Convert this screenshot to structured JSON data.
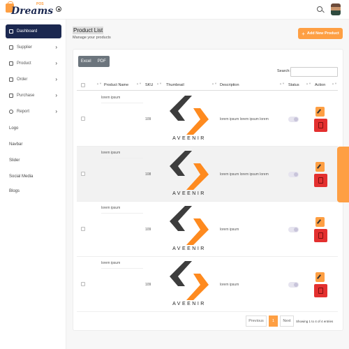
{
  "brand": {
    "small_text": "",
    "name": "Dreams",
    "pos": "POS"
  },
  "sidebar": {
    "items": [
      {
        "label": "Dashboard",
        "icon": "home-icon",
        "active": true
      },
      {
        "label": "Supplier",
        "icon": "supplier-icon",
        "chevron": "›"
      },
      {
        "label": "Product",
        "icon": "product-icon",
        "chevron": "›"
      },
      {
        "label": "Order",
        "icon": "order-icon",
        "chevron": "›"
      },
      {
        "label": "Purchase",
        "icon": "purchase-icon",
        "chevron": "›"
      },
      {
        "label": "Report",
        "icon": "report-icon",
        "chevron": "›"
      }
    ],
    "links": [
      "Logo",
      "Navbar",
      "Slider",
      "Social Media",
      "Blogs"
    ]
  },
  "page": {
    "title": "Product List",
    "subtitle": "Manage your products",
    "add_button": "Add New Product",
    "add_icon": "+"
  },
  "toolbar": {
    "excel": "Excel",
    "pdf": "PDF",
    "search_label": "Search:",
    "search_value": ""
  },
  "table": {
    "headers": {
      "name": "Product Name",
      "sku": "SKU",
      "thumbnail": "Thumbnail",
      "description": "Description",
      "status": "Status",
      "action": "Action"
    },
    "sort_glyph": "▲▼",
    "rows": [
      {
        "name": "lorem ipsum",
        "sku": "109",
        "thumb_text": "AVEENIR",
        "description": "lorem ipsum lorem ipsum lorem",
        "status_on": false
      },
      {
        "name": "lorem ipsum",
        "sku": "108",
        "thumb_text": "AVEENIR",
        "description": "lorem ipsum lorem ipsum lorem",
        "status_on": false
      },
      {
        "name": "lorem ipsum",
        "sku": "109",
        "thumb_text": "AVEENIR",
        "description": "lorem ipsum",
        "status_on": false
      },
      {
        "name": "lorem ipsum",
        "sku": "109",
        "thumb_text": "AVEENIR",
        "description": "lorem ipsum",
        "status_on": false
      }
    ]
  },
  "pagination": {
    "previous": "Previous",
    "current": "1",
    "next": "Next",
    "info": "Showing 1 to 4 of 4 entries"
  },
  "colors": {
    "accent": "#fe9f43",
    "navy": "#1b2850",
    "danger": "#e3302f",
    "logo_dark": "#3d3d3d"
  }
}
